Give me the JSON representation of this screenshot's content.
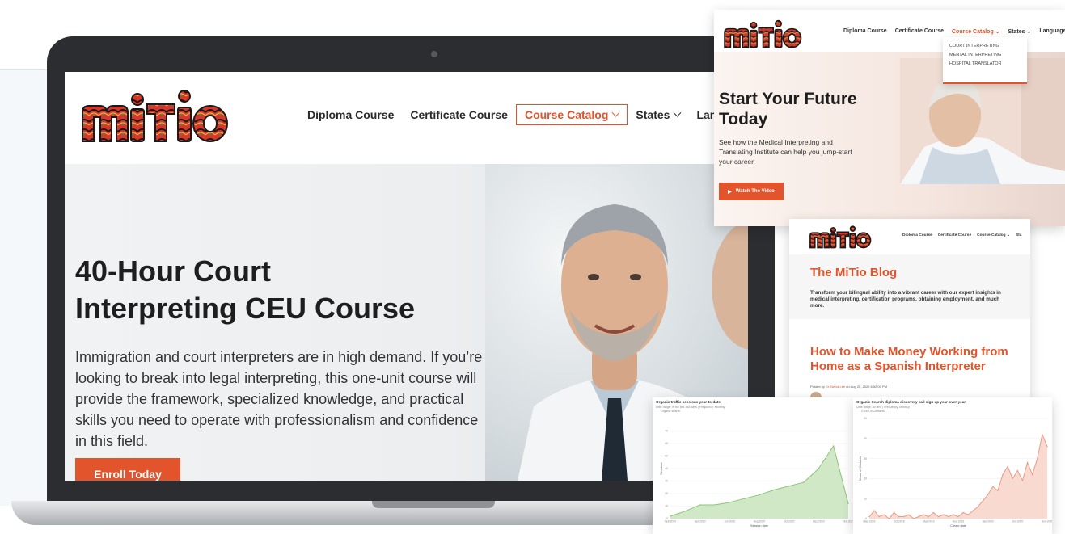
{
  "colors": {
    "accent": "#e2542c",
    "text": "#1e1e1e",
    "laptop": "#2b2d31",
    "chart_green": "#c9e4bd",
    "chart_pink": "#f8d3c8"
  },
  "main_site": {
    "nav": [
      {
        "label": "Diploma Course",
        "has_dropdown": false,
        "active": false
      },
      {
        "label": "Certificate Course",
        "has_dropdown": false,
        "active": false
      },
      {
        "label": "Course Catalog",
        "has_dropdown": true,
        "active": true
      },
      {
        "label": "States",
        "has_dropdown": true,
        "active": false
      },
      {
        "label": "Language",
        "has_dropdown": false,
        "active": false
      }
    ],
    "hero": {
      "title_line1": "40-Hour Court",
      "title_line2": "Interpreting CEU Course",
      "text": "Immigration and court interpreters are in high demand. If you’re looking to break into legal interpreting, this one-unit course will provide the framework, specialized knowledge, and practical skills you need to operate with professionalism and confidence in this field.",
      "button": "Enroll Today"
    }
  },
  "card_home": {
    "nav": {
      "diploma": "Diploma Course",
      "certificate": "Certificate Course",
      "catalog": "Course Catalog",
      "states": "States",
      "languages": "Languages"
    },
    "dropdown": [
      "COURT INTERPRETING",
      "MENTAL INTERPRETING",
      "HOSPITAL TRANSLATOR"
    ],
    "title_line1": "Start Your Future",
    "title_line2": "Today",
    "text": "See how the Medical Interpreting and Translating Institute can help you jump-start your career.",
    "button": "Watch The Video"
  },
  "card_blog": {
    "nav": {
      "diploma": "Diploma Course",
      "certificate": "Certificate Course",
      "catalog": "Course Catalog",
      "states": "Sta"
    },
    "title": "The MiTio Blog",
    "subtitle": "Transform your bilingual ability into a vibrant career with our expert insights in medical interpreting, certification programs, obtaining employment, and much more.",
    "post_title": "How to Make Money Working from Home as a Spanish Interpreter",
    "post_meta_prefix": "Posted by ",
    "post_author": "Dr. Nelva Lee",
    "post_date": " on Aug 25, 2020 6:52:00 PM"
  },
  "chart_data": [
    {
      "type": "area",
      "title": "Organic traffic sessions year-to-date",
      "subtitle": "Date range: In the last 365 days  |  Frequency: Monthly",
      "legend": [
        "Organic search"
      ],
      "ylabel": "Sessions",
      "xlabel": "Session date",
      "x": [
        "Feb 2020",
        "Mar 2020",
        "Apr 2020",
        "May 2020",
        "Jun 2020",
        "Jul 2020",
        "Aug 2020",
        "Sep 2020",
        "Oct 2020",
        "Nov 2020",
        "Dec 2020",
        "Jan 2021",
        "Feb 2021"
      ],
      "x_ticks": [
        "Feb 2020",
        "Apr 2020",
        "Jun 2020",
        "Aug 2020",
        "Oct 2020",
        "Dec 2020",
        "Feb 2021"
      ],
      "values": [
        2,
        6,
        11,
        11,
        13,
        16,
        19,
        23,
        26,
        29,
        40,
        58,
        12
      ],
      "ylim": [
        0,
        80
      ],
      "y_ticks": [
        "0",
        "10",
        "20",
        "30",
        "40",
        "50",
        "60",
        "70"
      ],
      "color": "#c9e4bd",
      "stroke": "#8cc47a"
    },
    {
      "type": "area",
      "title": "Organic Search diploma discovery call sign up year-over-year",
      "subtitle": "Date range: All time  |  Frequency: Monthly",
      "legend": [
        "Count of Contacts"
      ],
      "ylabel": "Count of Contacts",
      "xlabel": "Create date",
      "x_ticks": [
        "May 2018",
        "Oct 2018",
        "Mar 2019",
        "Aug 2019",
        "Jan 2020",
        "Jun 2020",
        "Nov 2020"
      ],
      "values": [
        1,
        4,
        1,
        2,
        0,
        3,
        1,
        1,
        2,
        0,
        1,
        2,
        1,
        3,
        1,
        2,
        1,
        2,
        1,
        3,
        2,
        4,
        6,
        9,
        12,
        16,
        14,
        22,
        26,
        20,
        24,
        19,
        28,
        22,
        30,
        42,
        36
      ],
      "ylim": [
        0,
        50
      ],
      "y_ticks": [
        "0",
        "10",
        "20",
        "30",
        "40",
        "50"
      ],
      "color": "#f8d3c8",
      "stroke": "#e99b86"
    }
  ]
}
